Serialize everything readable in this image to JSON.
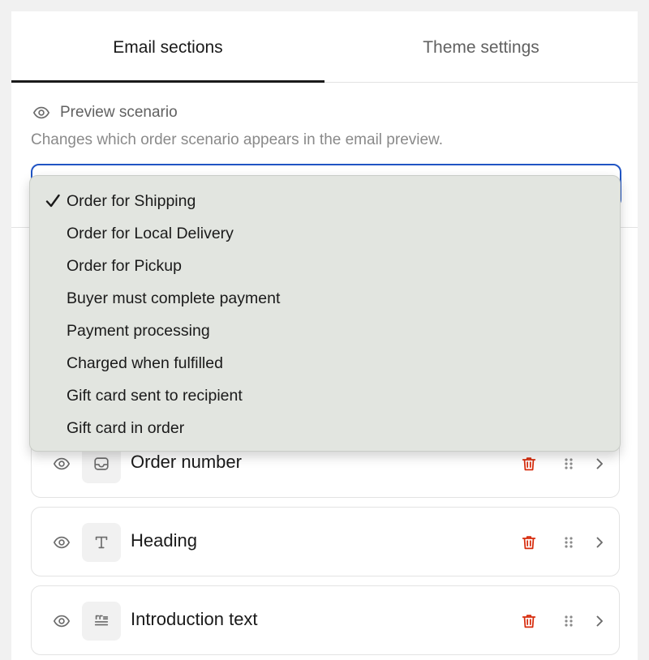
{
  "tabs": [
    {
      "label": "Email sections",
      "active": true
    },
    {
      "label": "Theme settings",
      "active": false
    }
  ],
  "preview": {
    "title": "Preview scenario",
    "help": "Changes which order scenario appears in the email preview.",
    "options": [
      {
        "label": "Order for Shipping",
        "selected": true
      },
      {
        "label": "Order for Local Delivery",
        "selected": false
      },
      {
        "label": "Order for Pickup",
        "selected": false
      },
      {
        "label": "Buyer must complete payment",
        "selected": false
      },
      {
        "label": "Payment processing",
        "selected": false
      },
      {
        "label": "Charged when fulfilled",
        "selected": false
      },
      {
        "label": "Gift card sent to recipient",
        "selected": false
      },
      {
        "label": "Gift card in order",
        "selected": false
      }
    ]
  },
  "sections": [
    {
      "label": "Order number",
      "icon": "inbox-icon"
    },
    {
      "label": "Heading",
      "icon": "text-icon"
    },
    {
      "label": "Introduction text",
      "icon": "paragraph-icon"
    }
  ],
  "colors": {
    "accent_focus": "#2155c4",
    "delete_red": "#d72c0d",
    "dropdown_bg": "#e2e5e0"
  }
}
